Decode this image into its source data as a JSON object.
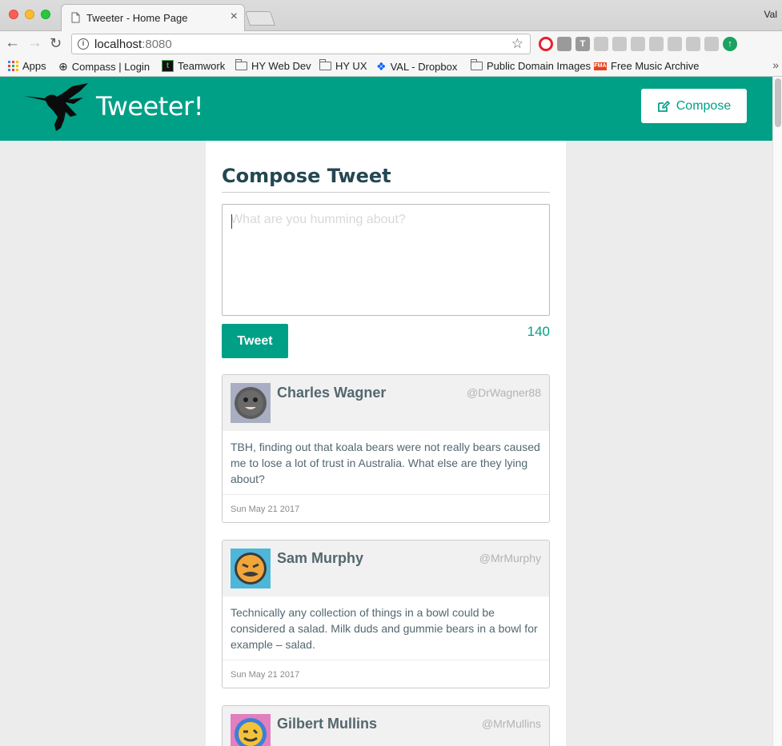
{
  "browser": {
    "tab_title": "Tweeter - Home Page",
    "tab_close": "×",
    "profile_name": "Val",
    "url_host": "localhost",
    "url_port": ":8080",
    "bookmarks": [
      {
        "label": "Apps",
        "icon": "apps-grid-icon"
      },
      {
        "label": "Compass | Login",
        "icon": "compass-icon"
      },
      {
        "label": "Teamwork",
        "icon": "teamwork-icon"
      },
      {
        "label": "HY Web Dev",
        "icon": "folder-icon"
      },
      {
        "label": "HY UX",
        "icon": "folder-icon"
      },
      {
        "label": "VAL - Dropbox",
        "icon": "dropbox-icon"
      },
      {
        "label": "Public Domain Images",
        "icon": "folder-icon"
      },
      {
        "label": "Free Music Archive",
        "icon": "fma-icon"
      }
    ],
    "more": "»"
  },
  "app": {
    "brand": "Tweeter!",
    "compose_button": "Compose",
    "accent_color": "#00a087"
  },
  "composer": {
    "title": "Compose Tweet",
    "placeholder": "What are you humming about?",
    "value": "",
    "button": "Tweet",
    "counter": "140"
  },
  "tweets": [
    {
      "name": "Charles Wagner",
      "handle": "@DrWagner88",
      "content": "TBH, finding out that koala bears were not really bears caused me to lose a lot of trust in Australia. What else are they lying about?",
      "date": "Sun May 21 2017",
      "avatar_bg": "#a9aec2",
      "avatar_fg": "#5b5b5b"
    },
    {
      "name": "Sam Murphy",
      "handle": "@MrMurphy",
      "content": "Technically any collection of things in a bowl could be considered a salad. Milk duds and gummie bears in a bowl for example – salad.",
      "date": "Sun May 21 2017",
      "avatar_bg": "#4eb6d8",
      "avatar_fg": "#f0a63a"
    },
    {
      "name": "Gilbert Mullins",
      "handle": "@MrMullins",
      "avatar_bg": "#e17fbf",
      "avatar_fg": "#3b7fd9"
    }
  ]
}
